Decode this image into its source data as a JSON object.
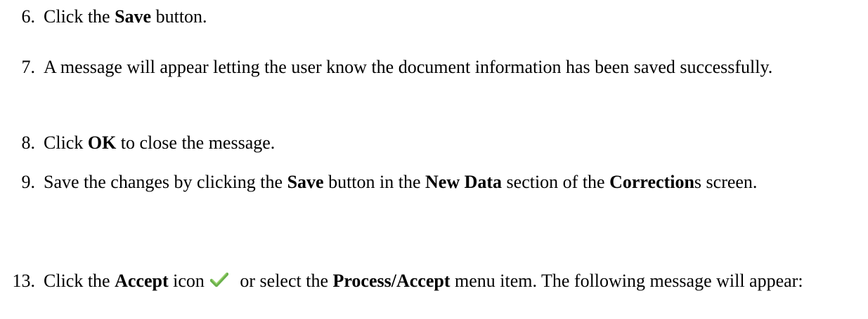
{
  "steps": [
    {
      "number": "6.",
      "parts": [
        "Click the ",
        "Save",
        " button."
      ]
    },
    {
      "number": "7.",
      "text": "A message will appear letting the user know the document information has been saved successfully."
    },
    {
      "number": "8.",
      "parts": [
        "Click ",
        "OK",
        " to close the message."
      ]
    },
    {
      "number": "9.",
      "parts": [
        "Save the changes by clicking the ",
        "Save",
        " button in the ",
        "New Data",
        " section of the ",
        "Correction",
        "s screen."
      ]
    },
    {
      "number": "13.",
      "parts": [
        "Click the ",
        "Accept",
        " icon",
        " or select the ",
        "Process/Accept",
        " menu item. The following message will appear:"
      ],
      "icon": "checkmark-icon",
      "icon_color": "#6ab04c"
    }
  ]
}
